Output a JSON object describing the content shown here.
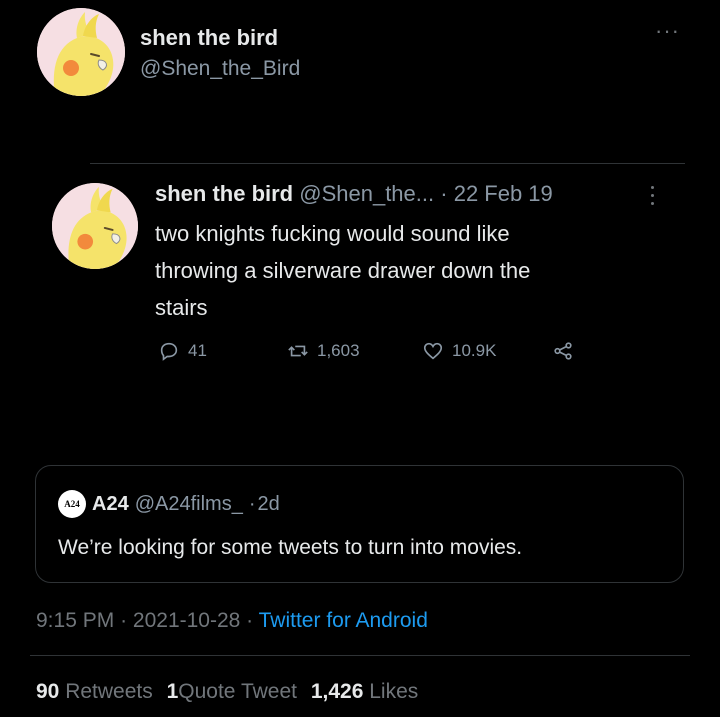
{
  "header": {
    "display_name": "shen the bird",
    "handle": "@Shen_the_Bird",
    "more_icon": "more-horizontal-icon"
  },
  "embedded_tweet": {
    "display_name": "shen the bird",
    "handle_truncated": "@Shen_the...",
    "separator": "·",
    "date": "22 Feb 19",
    "more_icon": "more-vertical-icon",
    "text_lines": [
      "two knights fucking would sound like",
      "throwing a silverware drawer down the",
      "stairs"
    ],
    "actions": {
      "reply_count": "41",
      "retweet_count": "1,603",
      "like_count": "10.9K"
    }
  },
  "quoted_tweet": {
    "logo_text": "A24",
    "display_name": "A24",
    "handle": "@A24films_",
    "separator": "·",
    "time": "2d",
    "text": "We’re looking for some tweets to turn into movies."
  },
  "meta": {
    "time": "9:15 PM",
    "sep1": "·",
    "date": "2021-10-28",
    "sep2": "·",
    "source": "Twitter for Android"
  },
  "stats": {
    "retweets_count": "90",
    "retweets_label": "Retweets",
    "quotes_count": "1",
    "quotes_label": "Quote Tweet",
    "likes_count": "1,426",
    "likes_label": "Likes"
  },
  "colors": {
    "background": "#000000",
    "text": "#e7e9ea",
    "muted": "#71767b",
    "link": "#1d9bf0",
    "border": "#2f3336"
  }
}
